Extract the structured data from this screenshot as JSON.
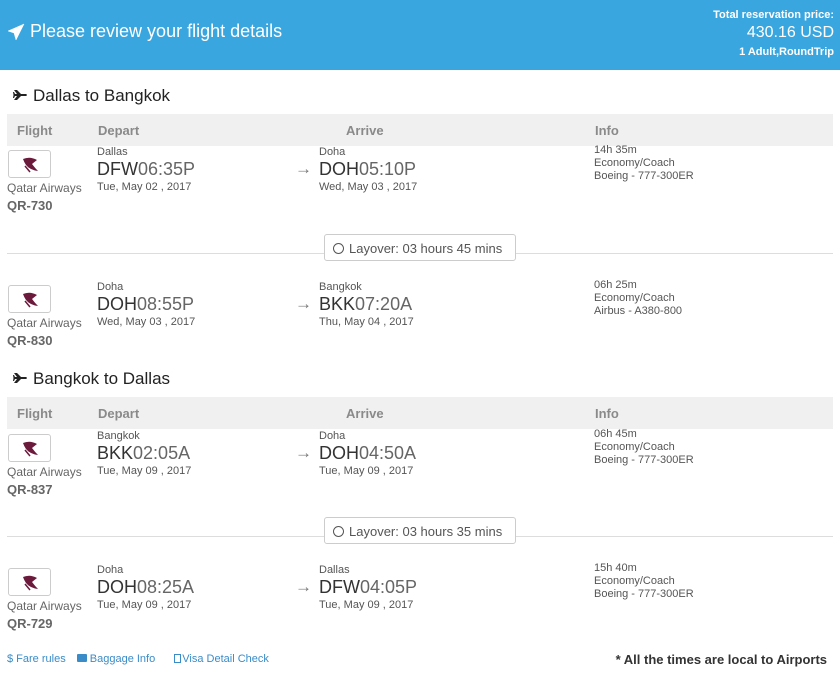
{
  "header": {
    "title": "Please review your flight details",
    "price_label": "Total reservation price:",
    "price": "430.16 USD",
    "passengers": "1 Adult,RoundTrip"
  },
  "columns": {
    "flight": "Flight",
    "depart": "Depart",
    "arrive": "Arrive",
    "info": "Info"
  },
  "routes": [
    {
      "title": "Dallas to Bangkok",
      "segments": [
        {
          "airline": "Qatar Airways",
          "flight_no": "QR-730",
          "dep_city": "Dallas",
          "dep_code": "DFW",
          "dep_time": "06:35P",
          "dep_date": "Tue, May 02 , 2017",
          "arr_city": "Doha",
          "arr_code": "DOH",
          "arr_time": "05:10P",
          "arr_date": "Wed, May 03 , 2017",
          "duration": "14h 35m",
          "cabin": "Economy/Coach",
          "aircraft": "Boeing - 777-300ER"
        },
        {
          "airline": "Qatar Airways",
          "flight_no": "QR-830",
          "dep_city": "Doha",
          "dep_code": "DOH",
          "dep_time": "08:55P",
          "dep_date": "Wed, May 03 , 2017",
          "arr_city": "Bangkok",
          "arr_code": "BKK",
          "arr_time": "07:20A",
          "arr_date": "Thu, May 04 , 2017",
          "duration": "06h 25m",
          "cabin": "Economy/Coach",
          "aircraft": "Airbus - A380-800"
        }
      ],
      "layover": "Layover: 03 hours 45 mins"
    },
    {
      "title": "Bangkok to Dallas",
      "segments": [
        {
          "airline": "Qatar Airways",
          "flight_no": "QR-837",
          "dep_city": "Bangkok",
          "dep_code": "BKK",
          "dep_time": "02:05A",
          "dep_date": "Tue, May 09 , 2017",
          "arr_city": "Doha",
          "arr_code": "DOH",
          "arr_time": "04:50A",
          "arr_date": "Tue, May 09 , 2017",
          "duration": "06h 45m",
          "cabin": "Economy/Coach",
          "aircraft": "Boeing - 777-300ER"
        },
        {
          "airline": "Qatar Airways",
          "flight_no": "QR-729",
          "dep_city": "Doha",
          "dep_code": "DOH",
          "dep_time": "08:25A",
          "dep_date": "Tue, May 09 , 2017",
          "arr_city": "Dallas",
          "arr_code": "DFW",
          "arr_time": "04:05P",
          "arr_date": "Tue, May 09 , 2017",
          "duration": "15h 40m",
          "cabin": "Economy/Coach",
          "aircraft": "Boeing - 777-300ER"
        }
      ],
      "layover": "Layover: 03 hours 35 mins"
    }
  ],
  "footer": {
    "fare_rules": "$ Fare rules",
    "baggage": "Baggage Info",
    "visa": "Visa Detail Check",
    "note": "* All the times are local to Airports"
  },
  "icons": {
    "header": "paper-plane-icon",
    "route": "airplane-icon",
    "layover": "clock-icon",
    "airline_logo": "qatar-airways-logo"
  },
  "colors": {
    "header_bg": "#3aa6df",
    "link": "#3a8cc9",
    "column_bar": "#f0f0f0"
  }
}
